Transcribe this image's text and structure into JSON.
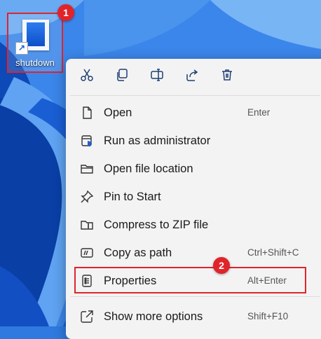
{
  "desktop": {
    "shortcut_label": "shutdown"
  },
  "callouts": {
    "one": "1",
    "two": "2"
  },
  "toolbar": {
    "cut": "scissors-icon",
    "copy": "copy-icon",
    "rename": "rename-icon",
    "share": "share-icon",
    "delete": "trash-icon"
  },
  "menu": {
    "items": [
      {
        "label": "Open",
        "shortcut": "Enter",
        "icon": "document-icon"
      },
      {
        "label": "Run as administrator",
        "shortcut": "",
        "icon": "shield-icon"
      },
      {
        "label": "Open file location",
        "shortcut": "",
        "icon": "folder-icon"
      },
      {
        "label": "Pin to Start",
        "shortcut": "",
        "icon": "pin-icon"
      },
      {
        "label": "Compress to ZIP file",
        "shortcut": "",
        "icon": "zip-folder-icon"
      },
      {
        "label": "Copy as path",
        "shortcut": "Ctrl+Shift+C",
        "icon": "path-icon"
      },
      {
        "label": "Properties",
        "shortcut": "Alt+Enter",
        "icon": "properties-icon"
      },
      {
        "label": "Show more options",
        "shortcut": "Shift+F10",
        "icon": "more-options-icon"
      }
    ]
  },
  "colors": {
    "highlight": "#e0242b",
    "wallpaper": "#2f7ae0"
  }
}
